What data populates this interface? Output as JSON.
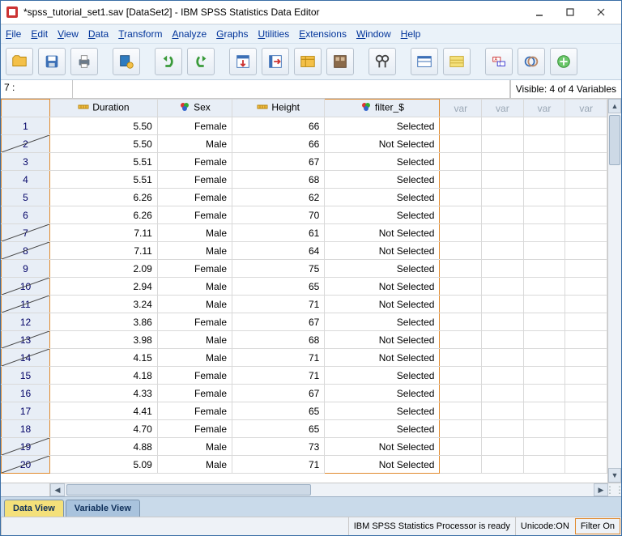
{
  "titlebar": {
    "title": "*spss_tutorial_set1.sav [DataSet2] - IBM SPSS Statistics Data Editor"
  },
  "menus": [
    "File",
    "Edit",
    "View",
    "Data",
    "Transform",
    "Analyze",
    "Graphs",
    "Utilities",
    "Extensions",
    "Window",
    "Help"
  ],
  "cellref": "7 :",
  "visible_vars": "Visible: 4 of 4 Variables",
  "columns": [
    {
      "label": "Duration",
      "icon": "ruler"
    },
    {
      "label": "Sex",
      "icon": "nominal"
    },
    {
      "label": "Height",
      "icon": "ruler"
    },
    {
      "label": "filter_$",
      "icon": "nominal"
    }
  ],
  "placeholder_cols": [
    "var",
    "var",
    "var",
    "var"
  ],
  "rows": [
    {
      "n": "1",
      "strike": false,
      "Duration": "5.50",
      "Sex": "Female",
      "Height": "66",
      "filter": "Selected"
    },
    {
      "n": "2",
      "strike": true,
      "Duration": "5.50",
      "Sex": "Male",
      "Height": "66",
      "filter": "Not Selected"
    },
    {
      "n": "3",
      "strike": false,
      "Duration": "5.51",
      "Sex": "Female",
      "Height": "67",
      "filter": "Selected"
    },
    {
      "n": "4",
      "strike": false,
      "Duration": "5.51",
      "Sex": "Female",
      "Height": "68",
      "filter": "Selected"
    },
    {
      "n": "5",
      "strike": false,
      "Duration": "6.26",
      "Sex": "Female",
      "Height": "62",
      "filter": "Selected"
    },
    {
      "n": "6",
      "strike": false,
      "Duration": "6.26",
      "Sex": "Female",
      "Height": "70",
      "filter": "Selected"
    },
    {
      "n": "7",
      "strike": true,
      "Duration": "7.11",
      "Sex": "Male",
      "Height": "61",
      "filter": "Not Selected"
    },
    {
      "n": "8",
      "strike": true,
      "Duration": "7.11",
      "Sex": "Male",
      "Height": "64",
      "filter": "Not Selected"
    },
    {
      "n": "9",
      "strike": false,
      "Duration": "2.09",
      "Sex": "Female",
      "Height": "75",
      "filter": "Selected"
    },
    {
      "n": "10",
      "strike": true,
      "Duration": "2.94",
      "Sex": "Male",
      "Height": "65",
      "filter": "Not Selected"
    },
    {
      "n": "11",
      "strike": true,
      "Duration": "3.24",
      "Sex": "Male",
      "Height": "71",
      "filter": "Not Selected"
    },
    {
      "n": "12",
      "strike": false,
      "Duration": "3.86",
      "Sex": "Female",
      "Height": "67",
      "filter": "Selected"
    },
    {
      "n": "13",
      "strike": true,
      "Duration": "3.98",
      "Sex": "Male",
      "Height": "68",
      "filter": "Not Selected"
    },
    {
      "n": "14",
      "strike": true,
      "Duration": "4.15",
      "Sex": "Male",
      "Height": "71",
      "filter": "Not Selected"
    },
    {
      "n": "15",
      "strike": false,
      "Duration": "4.18",
      "Sex": "Female",
      "Height": "71",
      "filter": "Selected"
    },
    {
      "n": "16",
      "strike": false,
      "Duration": "4.33",
      "Sex": "Female",
      "Height": "67",
      "filter": "Selected"
    },
    {
      "n": "17",
      "strike": false,
      "Duration": "4.41",
      "Sex": "Female",
      "Height": "65",
      "filter": "Selected"
    },
    {
      "n": "18",
      "strike": false,
      "Duration": "4.70",
      "Sex": "Female",
      "Height": "65",
      "filter": "Selected"
    },
    {
      "n": "19",
      "strike": true,
      "Duration": "4.88",
      "Sex": "Male",
      "Height": "73",
      "filter": "Not Selected"
    },
    {
      "n": "20",
      "strike": true,
      "Duration": "5.09",
      "Sex": "Male",
      "Height": "71",
      "filter": "Not Selected"
    }
  ],
  "tabs": {
    "data_view": "Data View",
    "variable_view": "Variable View"
  },
  "status": {
    "processor": "IBM SPSS Statistics Processor is ready",
    "unicode": "Unicode:ON",
    "filter": "Filter On"
  }
}
